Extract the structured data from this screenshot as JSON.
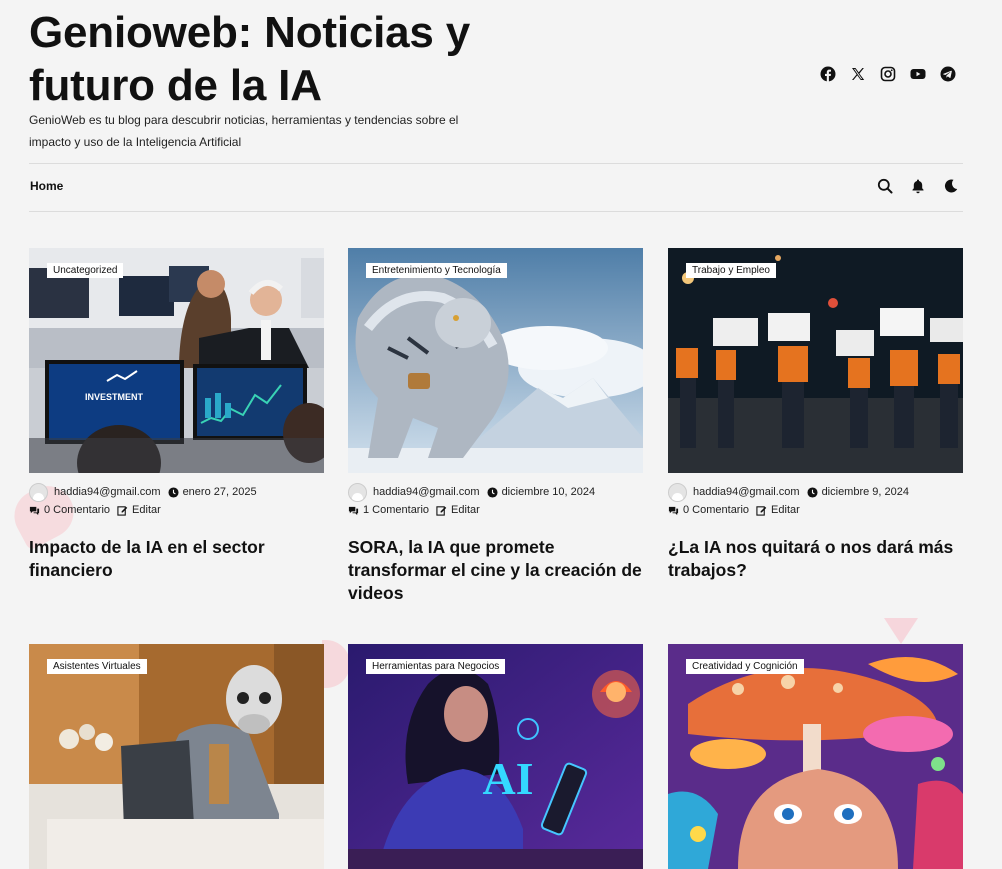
{
  "site": {
    "title": "Genioweb: Noticias y futuro de la IA",
    "tagline": "GenioWeb es tu blog para descubrir noticias, herramientas y tendencias sobre el impacto y uso de la Inteligencia Artificial"
  },
  "social": [
    "facebook-icon",
    "x-icon",
    "instagram-icon",
    "youtube-icon",
    "telegram-icon"
  ],
  "nav": {
    "home": "Home",
    "tools": [
      "search-icon",
      "bell-icon",
      "dark-mode-icon"
    ]
  },
  "posts": [
    {
      "category": "Uncategorized",
      "author": "haddia94@gmail.com",
      "date": "enero 27, 2025",
      "comments": "0 Comentario",
      "edit": "Editar",
      "title": "Impacto de la IA en el sector financiero",
      "image_text": "INVESTMENT"
    },
    {
      "category": "Entretenimiento y Tecnología",
      "author": "haddia94@gmail.com",
      "date": "diciembre 10, 2024",
      "comments": "1 Comentario",
      "edit": "Editar",
      "title": "SORA, la IA que promete transformar el cine y la creación de videos"
    },
    {
      "category": "Trabajo y Empleo",
      "author": "haddia94@gmail.com",
      "date": "diciembre 9, 2024",
      "comments": "0 Comentario",
      "edit": "Editar",
      "title": "¿La IA nos quitará o nos dará más trabajos?"
    },
    {
      "category": "Asistentes Virtuales"
    },
    {
      "category": "Herramientas para Negocios",
      "image_text": "AI"
    },
    {
      "category": "Creatividad y Cognición"
    }
  ],
  "colors": {
    "background": "#f4f4f4",
    "text": "#111111",
    "badge": "#ffffff"
  }
}
